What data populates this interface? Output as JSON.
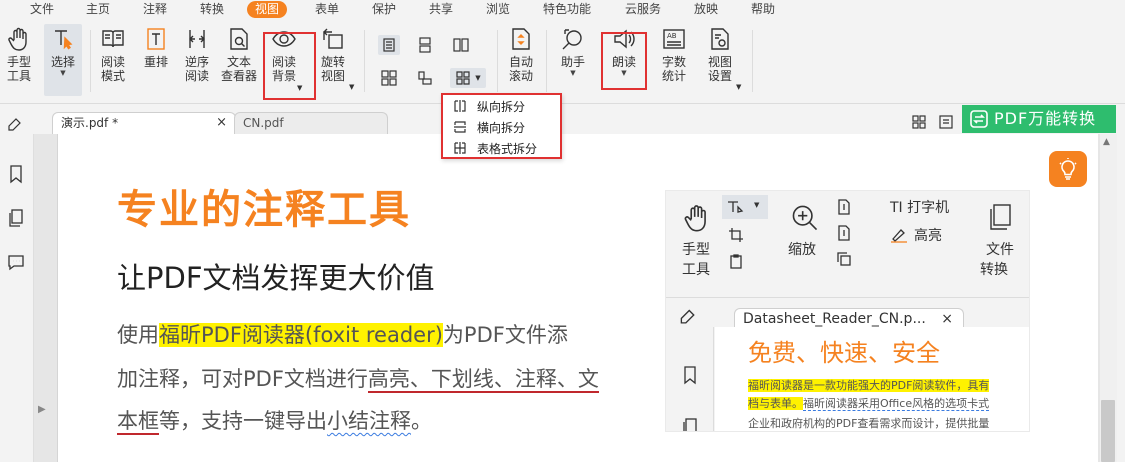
{
  "menu": {
    "items": [
      "文件",
      "主页",
      "注释",
      "转换",
      "视图",
      "表单",
      "保护",
      "共享",
      "浏览",
      "特色功能",
      "云服务",
      "放映",
      "帮助"
    ],
    "active_index": 4
  },
  "ribbon": {
    "hand": {
      "line1": "手型",
      "line2": "工具"
    },
    "select": {
      "label": "选择"
    },
    "read_mode": {
      "line1": "阅读",
      "line2": "模式"
    },
    "reflow": {
      "label": "重排"
    },
    "reverse": {
      "line1": "逆序",
      "line2": "阅读"
    },
    "text_viewer": {
      "line1": "文本",
      "line2": "查看器"
    },
    "read_bg": {
      "line1": "阅读",
      "line2": "背景"
    },
    "rotate": {
      "line1": "旋转",
      "line2": "视图"
    },
    "auto_scroll": {
      "line1": "自动",
      "line2": "滚动"
    },
    "assistant": {
      "label": "助手"
    },
    "read_aloud": {
      "label": "朗读"
    },
    "word_count": {
      "line1": "字数",
      "line2": "统计"
    },
    "view_settings": {
      "line1": "视图",
      "line2": "设置"
    }
  },
  "split_menu": {
    "vertical": "纵向拆分",
    "horizontal": "横向拆分",
    "table": "表格式拆分"
  },
  "tabs": [
    {
      "label": "演示.pdf *",
      "close": "×"
    },
    {
      "label": "CN.pdf"
    }
  ],
  "pdf_convert": {
    "label": "PDF万能转换"
  },
  "document": {
    "title": "专业的注释工具",
    "subtitle": "让PDF文档发挥更大价值",
    "para_prefix": "使用",
    "para_highlight": "福昕PDF阅读器(foxit reader)",
    "para_line1_end": "为PDF文件添",
    "para_line2_start": "加注释，可对PDF文档进行",
    "para_line2_ul": "高亮、下划线、注释、文",
    "para_line3_ul": "本框",
    "para_line3_mid": "等，支持一键导出",
    "para_line3_wave": "小结注释",
    "para_line3_end": "。"
  },
  "embedded": {
    "hand": {
      "line1": "手型",
      "line2": "工具"
    },
    "zoom": {
      "label": "缩放"
    },
    "typewriter": "TI 打字机",
    "highlight": "高亮",
    "file_convert": {
      "line1": "文件",
      "line2": "转换"
    },
    "tab_label": "Datasheet_Reader_CN.p...",
    "tab_close": "×",
    "title": "免费、快速、安全",
    "line1_highlight": "福昕阅读器是一款功能强大的PDF阅读软件，具有",
    "line2_highlight": "档与表单。",
    "line2_rest": "福昕阅读器采用Office风格的选项卡式",
    "line3": "企业和政府机构的PDF查看需求而设计，提供批量"
  },
  "colors": {
    "accent": "#f58220",
    "highlight_box": "#e03131",
    "convert_green": "#2ebd6e",
    "text_highlight": "#fff200"
  }
}
